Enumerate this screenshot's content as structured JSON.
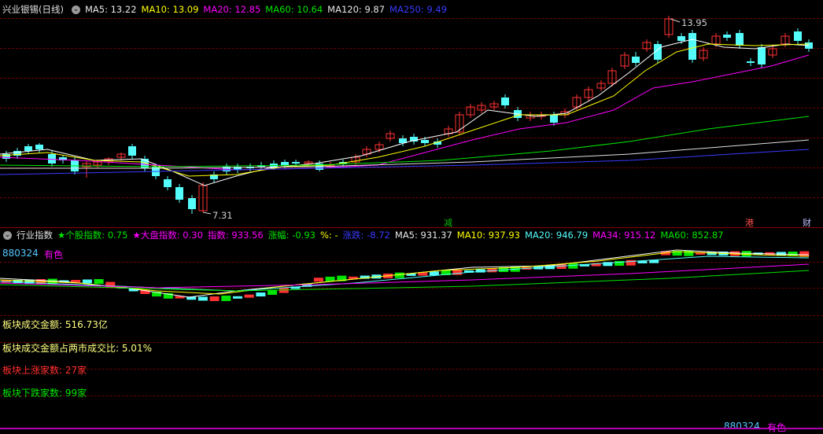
{
  "main_header": {
    "stock": "兴业银锡(日线)",
    "ma5": "MA5: 13.22",
    "ma10": "MA10: 13.09",
    "ma20": "MA20: 12.85",
    "ma60": "MA60: 10.64",
    "ma120": "MA120: 9.87",
    "ma250": "MA250: 9.49"
  },
  "price_labels": {
    "high": "13.95",
    "low": "7.31"
  },
  "event_markers": {
    "reduce": "减",
    "hk": "港",
    "finance": "财"
  },
  "sub_header": {
    "title": "行业指数",
    "stock_index": "★个股指数: 0.75",
    "market_index": "★大盘指数: 0.30",
    "index": "指数: 933.56",
    "change_pct": "涨幅: -0.93",
    "pct": "%: -",
    "change": "涨跌: -8.72",
    "ma5": "MA5: 931.37",
    "ma10": "MA10: 937.93",
    "ma20": "MA20: 946.79",
    "ma34": "MA34: 915.12",
    "ma60": "MA60: 852.87"
  },
  "sector": {
    "code": "880324",
    "name": "有色"
  },
  "stats": {
    "turnover": "板块成交金额: 516.73亿",
    "ratio": "板块成交金额占两市成交比: 5.01%",
    "up_count": "板块上涨家数: 27家",
    "down_count": "板块下跌家数: 99家"
  },
  "footer": {
    "code": "880324",
    "name": "有色"
  },
  "colors": {
    "up": "#ff3232",
    "down": "#54fcfc",
    "ma5": "#ffffff",
    "ma10": "#ffff00",
    "ma20": "#ff00ff",
    "ma60": "#00e600",
    "ma120": "#e0e0e0",
    "ma250": "#3a3aff"
  },
  "icons": {
    "collapse": "chevron-down-icon"
  }
}
